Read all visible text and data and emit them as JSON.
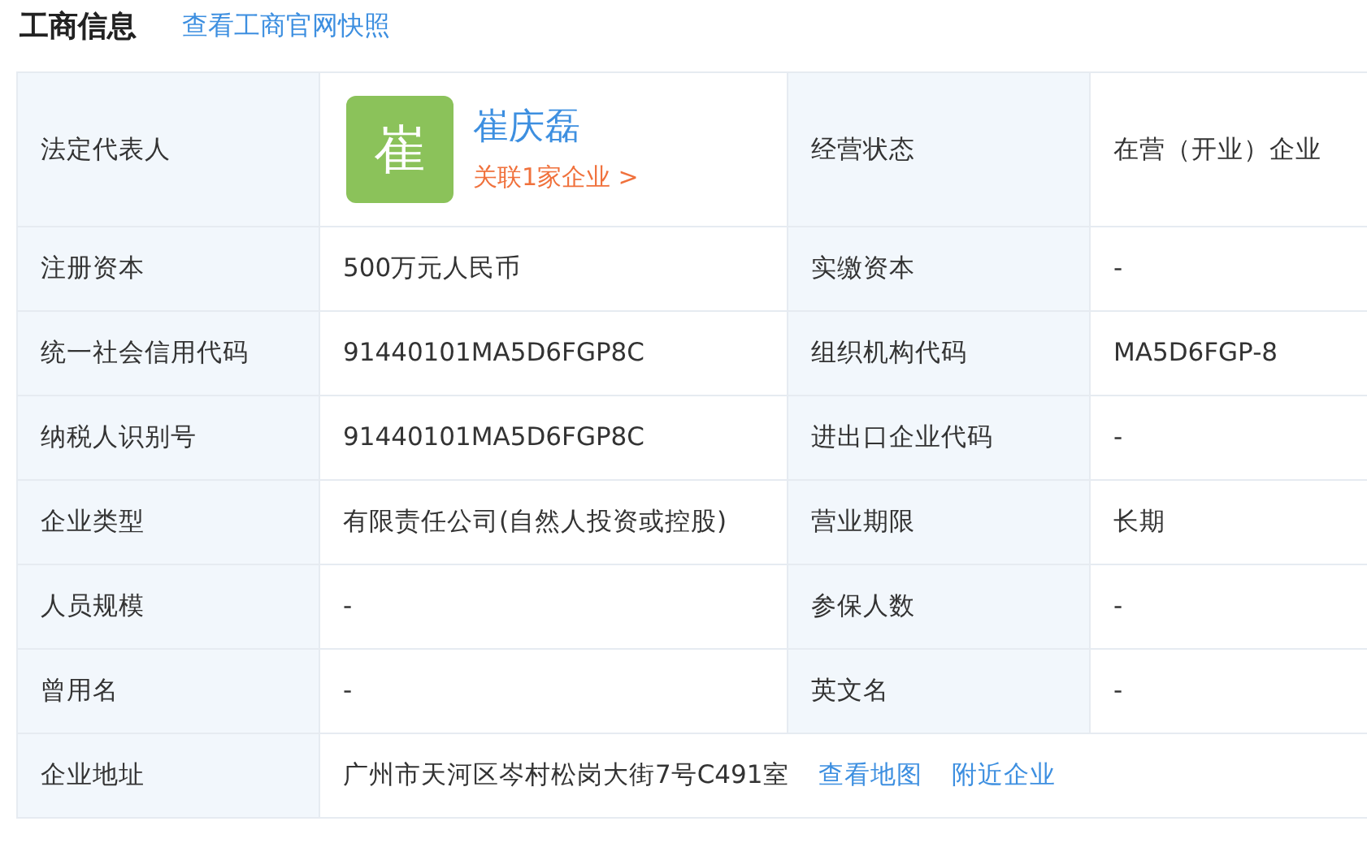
{
  "header": {
    "title": "工商信息",
    "link": "查看工商官网快照"
  },
  "table": {
    "rows": [
      {
        "cells": [
          {
            "kind": "label",
            "text": "法定代表人"
          },
          {
            "kind": "person",
            "avatar": "崔",
            "name": "崔庆磊",
            "related": "关联1家企业 >"
          },
          {
            "kind": "label",
            "text": "经营状态"
          },
          {
            "kind": "value",
            "text": "在营（开业）企业"
          }
        ]
      },
      {
        "cells": [
          {
            "kind": "label",
            "text": "注册资本"
          },
          {
            "kind": "value",
            "text": "500万元人民币"
          },
          {
            "kind": "label",
            "text": "实缴资本"
          },
          {
            "kind": "value",
            "text": "-"
          }
        ]
      },
      {
        "cells": [
          {
            "kind": "label",
            "text": "统一社会信用代码"
          },
          {
            "kind": "value",
            "text": "91440101MA5D6FGP8C"
          },
          {
            "kind": "label",
            "text": "组织机构代码"
          },
          {
            "kind": "value",
            "text": "MA5D6FGP-8"
          }
        ]
      },
      {
        "cells": [
          {
            "kind": "label",
            "text": "纳税人识别号"
          },
          {
            "kind": "value",
            "text": "91440101MA5D6FGP8C"
          },
          {
            "kind": "label",
            "text": "进出口企业代码"
          },
          {
            "kind": "value",
            "text": "-"
          }
        ]
      },
      {
        "cells": [
          {
            "kind": "label",
            "text": "企业类型"
          },
          {
            "kind": "value",
            "text": "有限责任公司(自然人投资或控股)"
          },
          {
            "kind": "label",
            "text": "营业期限"
          },
          {
            "kind": "value",
            "text": "长期"
          }
        ]
      },
      {
        "cells": [
          {
            "kind": "label",
            "text": "人员规模"
          },
          {
            "kind": "value",
            "text": "-"
          },
          {
            "kind": "label",
            "text": "参保人数"
          },
          {
            "kind": "value",
            "text": "-"
          }
        ]
      },
      {
        "cells": [
          {
            "kind": "label",
            "text": "曾用名"
          },
          {
            "kind": "value",
            "text": "-"
          },
          {
            "kind": "label",
            "text": "英文名"
          },
          {
            "kind": "value",
            "text": "-"
          }
        ]
      },
      {
        "cells": [
          {
            "kind": "label",
            "text": "企业地址"
          },
          {
            "kind": "address",
            "text": "广州市天河区岑村松岗大街7号C491室",
            "links": [
              "查看地图",
              "附近企业"
            ]
          }
        ]
      }
    ]
  }
}
